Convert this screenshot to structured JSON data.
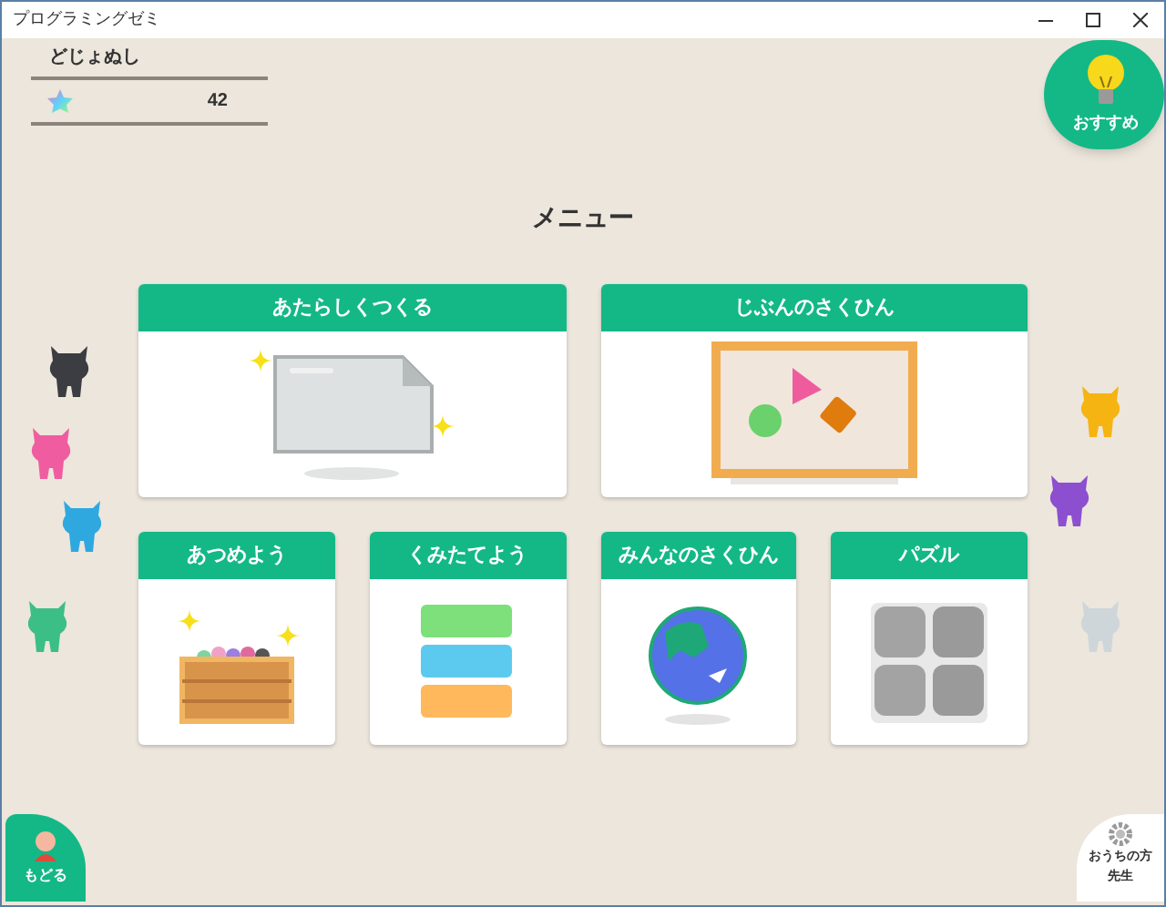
{
  "window": {
    "title": "プログラミングゼミ"
  },
  "user": {
    "name": "どじょぬし",
    "star_count": "42"
  },
  "recommend_button": {
    "label": "おすすめ"
  },
  "menu": {
    "title": "メニュー",
    "large_cards": [
      {
        "label": "あたらしくつくる",
        "kind": "new"
      },
      {
        "label": "じぶんのさくひん",
        "kind": "own"
      }
    ],
    "small_cards": [
      {
        "label": "あつめよう",
        "kind": "collect"
      },
      {
        "label": "くみたてよう",
        "kind": "build"
      },
      {
        "label": "みんなのさくひん",
        "kind": "everyone"
      },
      {
        "label": "パズル",
        "kind": "puzzle"
      }
    ]
  },
  "back_button": {
    "label": "もどる"
  },
  "parent_button": {
    "lines": [
      "おうちの方",
      "先生"
    ]
  }
}
